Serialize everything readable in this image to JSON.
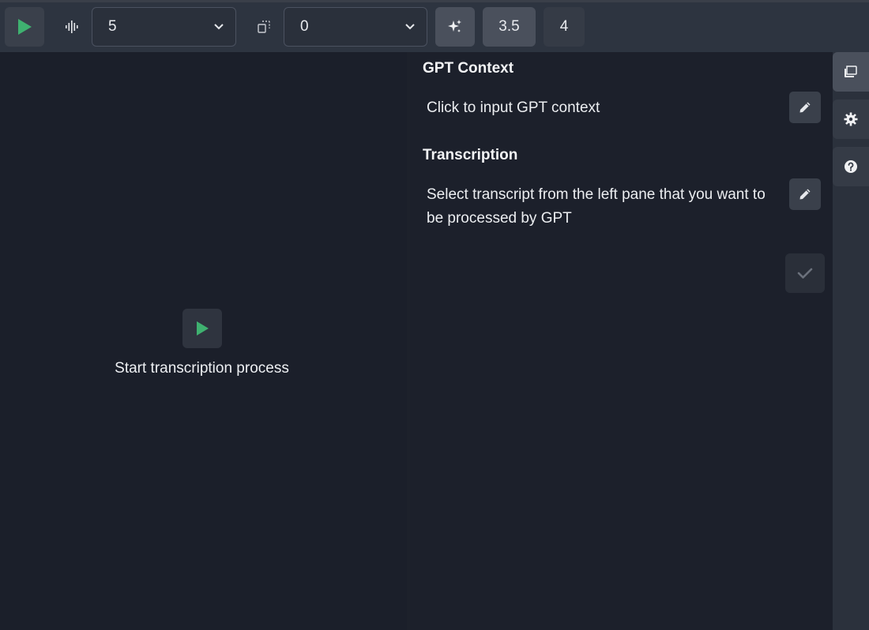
{
  "toolbar": {
    "play_icon": "play-icon",
    "audio_icon": "audio-waveform-icon",
    "select1": {
      "value": "5"
    },
    "copy_icon": "copy-icon",
    "select2": {
      "value": "0"
    },
    "magic_icon": "sparkles-icon",
    "gpt35_label": "3.5",
    "gpt4_label": "4"
  },
  "left_pane": {
    "start_label": "Start transcription process"
  },
  "right_pane": {
    "context_title": "GPT Context",
    "context_text": "Click to input GPT context",
    "transcription_title": "Transcription",
    "transcription_text": "Select transcript from the left pane that you want to be processed by GPT"
  },
  "side_rail": {
    "items": [
      "chat-icon",
      "gear-icon",
      "help-icon"
    ]
  },
  "colors": {
    "accent_green": "#3fb170",
    "background": "#1b1f2a",
    "toolbar": "#2d3440"
  }
}
